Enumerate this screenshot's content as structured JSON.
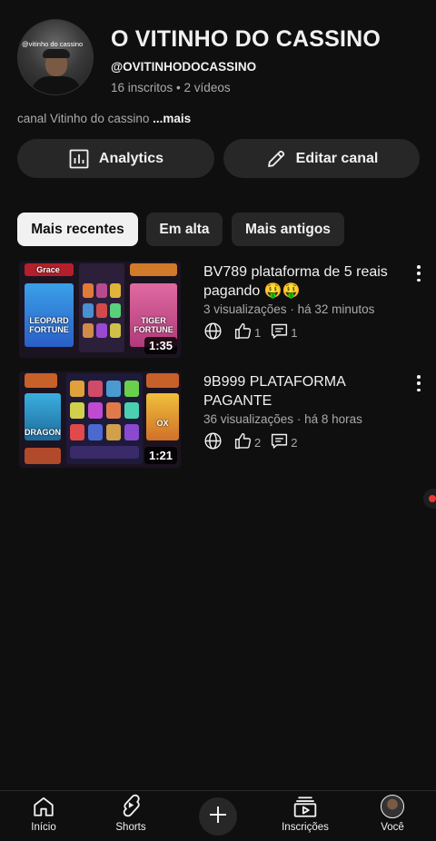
{
  "channel": {
    "avatar_overlay_text": "@vitinho do cassino",
    "name": "O VITINHO DO CASSINO",
    "handle": "@OVITINHODOCASSINO",
    "subscribers": "16 inscritos",
    "separator": "•",
    "videos_count": "2 vídeos",
    "description": "canal Vitinho do cassino",
    "description_more": "...mais"
  },
  "actions": {
    "analytics_label": "Analytics",
    "edit_label": "Editar canal"
  },
  "filters": {
    "chips": [
      {
        "label": "Mais recentes",
        "active": true
      },
      {
        "label": "Em alta",
        "active": false
      },
      {
        "label": "Mais antigos",
        "active": false
      }
    ]
  },
  "videos": [
    {
      "title": "BV789 plataforma de  5 reais pagando 🤑🤑",
      "views": "3 visualizações",
      "age": "há 32 minutos",
      "likes": "1",
      "comments": "1",
      "duration": "1:35",
      "thumb_labels": [
        "Grace",
        "LEOPARD FORTUNE",
        "TIGER FORTUNE"
      ]
    },
    {
      "title": "9B999 PLATAFORMA PAGANTE",
      "views": "36 visualizações",
      "age": "há 8 horas",
      "likes": "2",
      "comments": "2",
      "duration": "1:21",
      "thumb_labels": [
        "DRAGON",
        "OX"
      ]
    }
  ],
  "bottom_nav": {
    "home": "Início",
    "shorts": "Shorts",
    "subscriptions": "Inscrições",
    "you": "Você"
  },
  "colors": {
    "background": "#0f0f0f",
    "surface": "#272727",
    "text_primary": "#f1f1f1",
    "text_secondary": "#aaaaaa",
    "chip_active_bg": "#f1f1f1",
    "live_dot": "#e53935"
  }
}
